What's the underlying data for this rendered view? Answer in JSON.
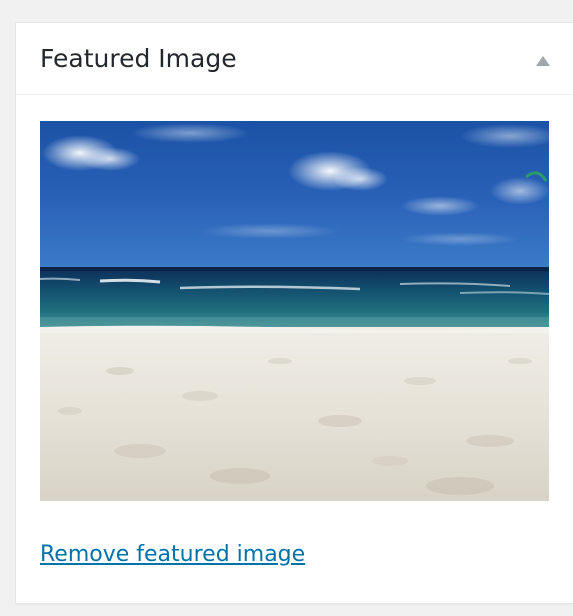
{
  "metabox": {
    "title": "Featured Image",
    "toggle_icon": "arrow-up-icon",
    "remove_link_label": "Remove featured image"
  },
  "featured_image": {
    "subject": "beach-photo"
  },
  "colors": {
    "link": "#0073aa",
    "title": "#23282d",
    "page_background": "#f1f1f1",
    "panel_background": "#ffffff",
    "toggle_arrow": "#a0a5aa"
  }
}
